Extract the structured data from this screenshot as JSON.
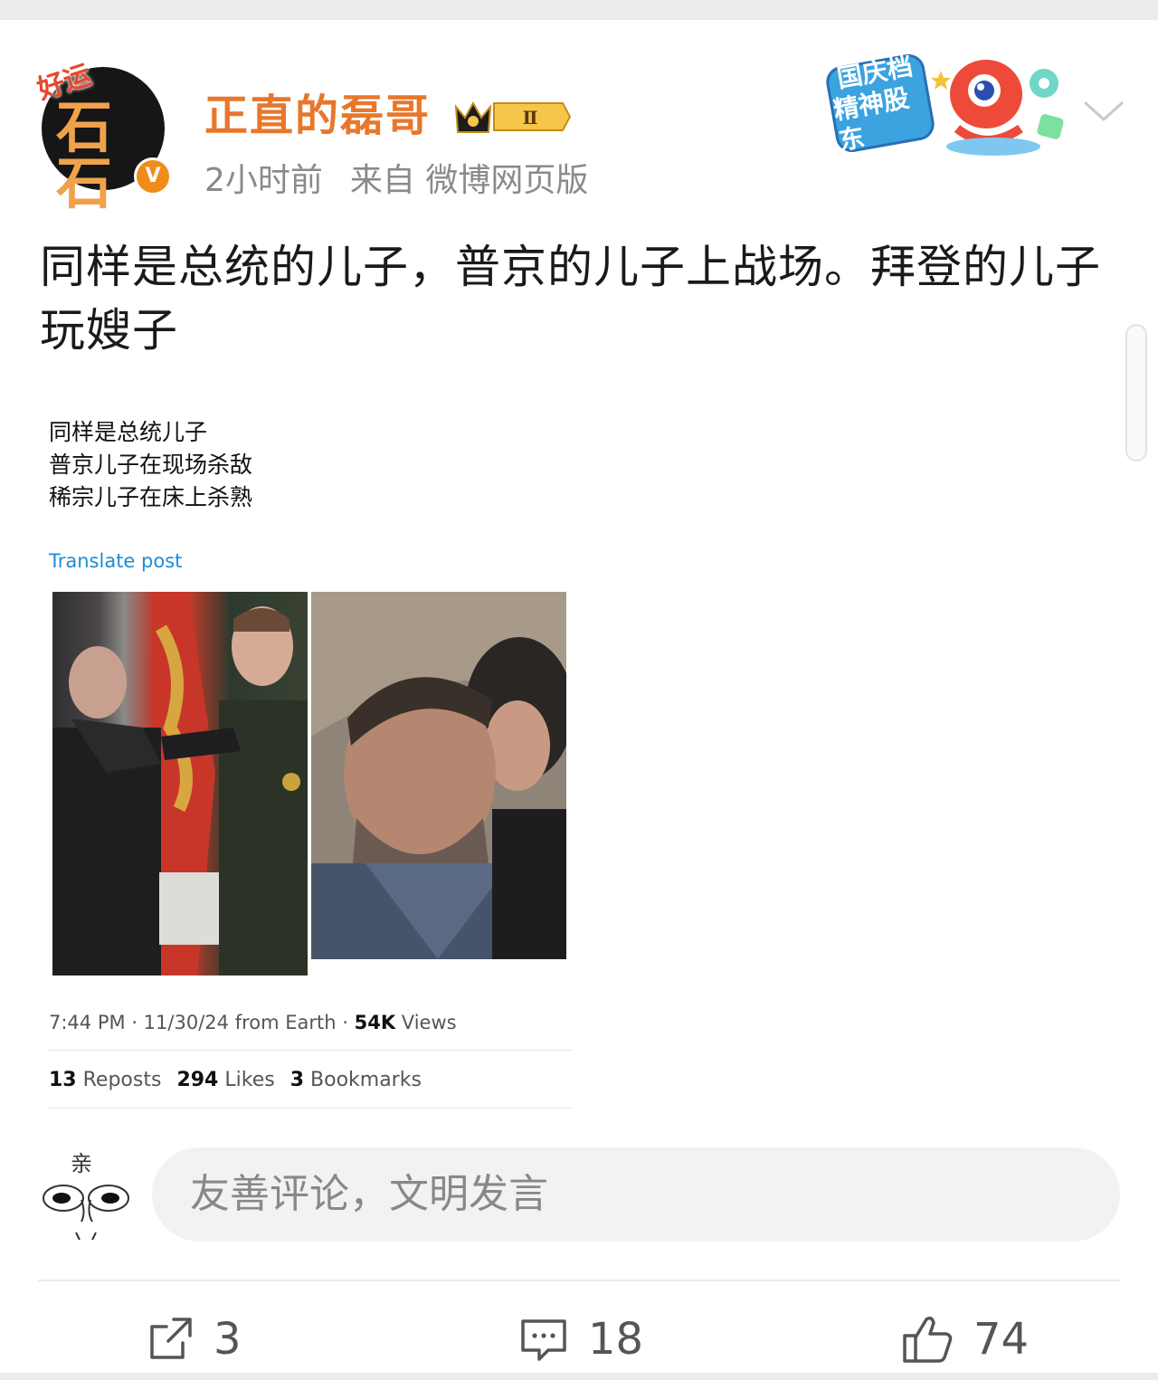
{
  "post": {
    "author": "正直的磊哥",
    "avatar_lucky_text": "好运",
    "avatar_stone_text": "石石",
    "level_badge": "Ⅱ",
    "time": "2小时前",
    "source": "来自 微博网页版",
    "promo_badge": {
      "line1": "国庆档",
      "line2": "精神股东"
    },
    "text": "同样是总统的儿子，普京的儿子上战场。拜登的儿子玩嫂子"
  },
  "embedded_tweet": {
    "lines": [
      "同样是总统儿子",
      "普京儿子在现场杀敌",
      "稀宗儿子在床上杀熟"
    ],
    "translate_label": "Translate post",
    "meta": {
      "time": "7:44 PM",
      "date": "11/30/24",
      "from": "from Earth",
      "views_count": "54K",
      "views_label": "Views"
    },
    "stats": {
      "reposts_count": "13",
      "reposts_label": "Reposts",
      "likes_count": "294",
      "likes_label": "Likes",
      "bookmarks_count": "3",
      "bookmarks_label": "Bookmarks"
    }
  },
  "comment_box": {
    "placeholder": "友善评论，文明发言",
    "avatar_text": "亲"
  },
  "actions": {
    "repost_count": "3",
    "comment_count": "18",
    "like_count": "74"
  },
  "colors": {
    "username": "#e8772c",
    "link": "#1d8cd8",
    "muted": "#8a8a8a",
    "verified_badge": "#f08c1a"
  }
}
